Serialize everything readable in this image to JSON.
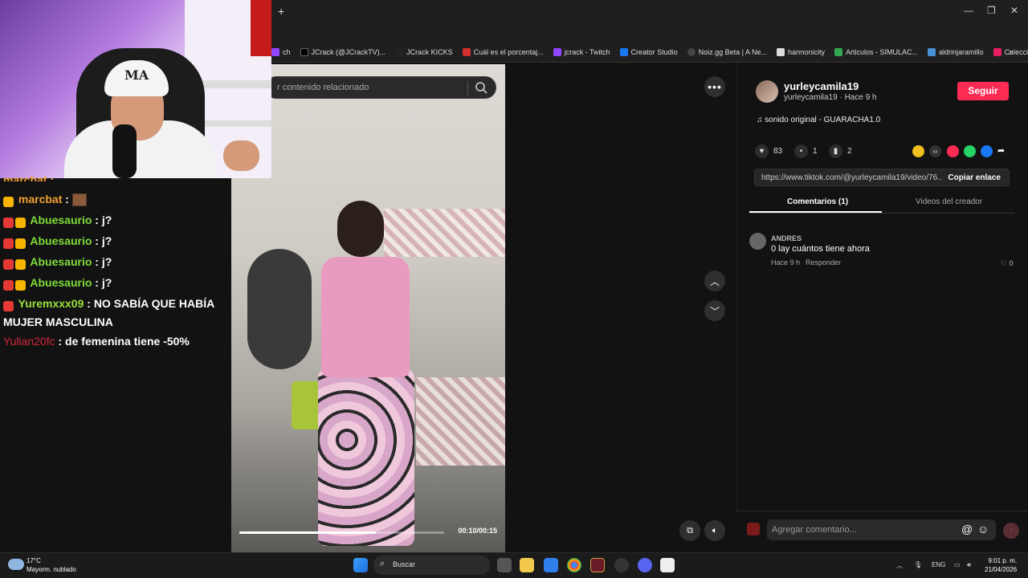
{
  "browser": {
    "new_tab": "+",
    "address_fragment": "54",
    "bookmarks": [
      {
        "label": "ch",
        "icon": "twitch-icon"
      },
      {
        "label": "JCrack (@JCrackTV)...",
        "icon": "x-icon"
      },
      {
        "label": "JCrack KICKS",
        "icon": "kick-icon"
      },
      {
        "label": "Cuál es el porcentaj...",
        "icon": "s-icon"
      },
      {
        "label": "jcrack - Twitch",
        "icon": "twitch-icon"
      },
      {
        "label": "Creator Studio",
        "icon": "facebook-icon"
      },
      {
        "label": "Noiz.gg Beta | A Ne...",
        "icon": "noiz-icon"
      },
      {
        "label": "harmonicity",
        "icon": "harmonicity-icon"
      },
      {
        "label": "Articulos - SIMULAC...",
        "icon": "drive-icon"
      },
      {
        "label": "aldrinjaramillo",
        "icon": "bookmark-icon"
      },
      {
        "label": "Colección de M_blei...",
        "icon": "collection-icon"
      }
    ],
    "more": "»"
  },
  "search": {
    "placeholder": "r contenido relacionado"
  },
  "video": {
    "time": "00:10/00:15",
    "progress": 0.667
  },
  "chat": [
    {
      "user": "marcbat",
      "text": ":",
      "color": "gold",
      "emote": true
    },
    {
      "user": "Abuesaurio",
      "text": ": j?",
      "color": "green"
    },
    {
      "user": "Abuesaurio",
      "text": ": j?",
      "color": "green"
    },
    {
      "user": "Abuesaurio",
      "text": ": j?",
      "color": "green"
    },
    {
      "user": "Abuesaurio",
      "text": ": j?",
      "color": "green"
    },
    {
      "user": "Yuremxxx09",
      "text": ": NO SABÍA QUE HABÍA MUJER MASCULINA",
      "color": "lime"
    },
    {
      "user": "Yulian20fc",
      "text": ": de femenina tiene -50%",
      "color": "red"
    }
  ],
  "chat_top_partial": "marcbat :",
  "post": {
    "username": "yurleycamila19",
    "subline": "yurleycamila19 · Hace 9 h",
    "follow": "Seguir",
    "sound": "sonido original - GUARACHA1.0",
    "likes": "83",
    "comments": "1",
    "saves": "2",
    "url": "https://www.tiktok.com/@yurleycamila19/video/76...",
    "copy": "Copiar enlace",
    "tab_comments": "Comentarios (1)",
    "tab_creator": "Videos del creador"
  },
  "comment": {
    "user": "ANDRES",
    "text": "0 lay cuántos tiene ahora",
    "time": "Hace 9 h",
    "reply": "Responder",
    "likes": "0"
  },
  "comment_input": {
    "placeholder": "Agregar comentario..."
  },
  "taskbar": {
    "weather_temp": "17°C",
    "weather_desc": "Mayorm. nublado",
    "search": "Buscar",
    "lang": "ENG",
    "time": "9:01 p. m.",
    "date": "21/04/2026"
  },
  "cam": {
    "cap_logo": "MA"
  },
  "colors": {
    "follow": "#fe2c55",
    "chat_gold": "#f0a030",
    "chat_green": "#7fdc3b",
    "chat_red": "#d3263a"
  }
}
